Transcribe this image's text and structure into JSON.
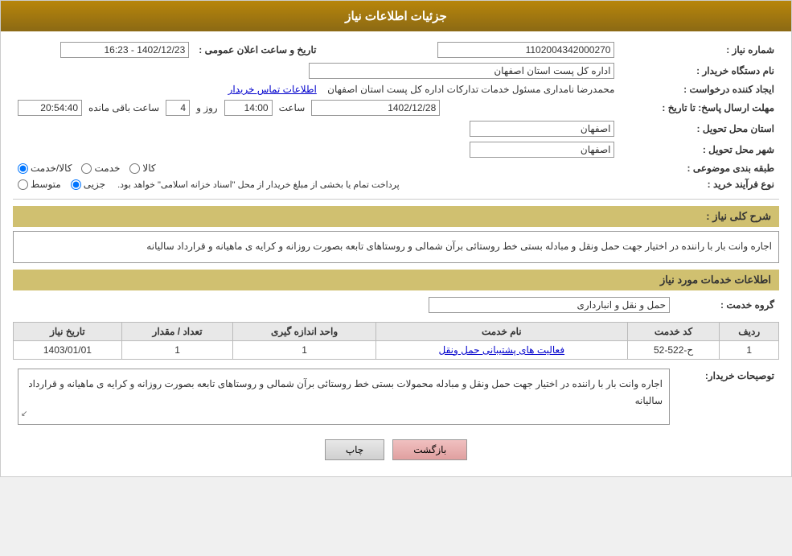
{
  "header": {
    "title": "جزئیات اطلاعات نیاز"
  },
  "labels": {
    "need_number": "شماره نیاز :",
    "buyer_org": "نام دستگاه خریدار :",
    "creator": "ایجاد کننده درخواست :",
    "deadline": "مهلت ارسال پاسخ: تا تاریخ :",
    "delivery_province": "استان محل تحویل :",
    "delivery_city": "شهر محل تحویل :",
    "subject_type": "طبقه بندی موضوعی :",
    "process_type": "نوع فرآیند خرید :",
    "need_summary": "شرح کلی نیاز:",
    "service_info_title": "اطلاعات خدمات مورد نیاز",
    "service_group": "گروه خدمت :",
    "buyer_notes": "توصیحات خریدار:",
    "announce_datetime": "تاریخ و ساعت اعلان عمومی :"
  },
  "values": {
    "need_number": "1102004342000270",
    "buyer_org": "اداره کل پست استان اصفهان",
    "creator": "محمدرضا نامداری مسئول خدمات تداركات اداره كل پست استان اصفهان",
    "creator_link": "اطلاعات تماس خریدار",
    "deadline_date": "1402/12/28",
    "deadline_time": "14:00",
    "deadline_days": "4",
    "deadline_remaining": "20:54:40",
    "delivery_province": "اصفهان",
    "delivery_city": "اصفهان",
    "announce_datetime": "1402/12/23 - 16:23",
    "subject_type_options": [
      "کالا",
      "خدمت",
      "کالا/خدمت"
    ],
    "subject_type_selected": "کالا/خدمت",
    "process_type_options": [
      "جزیی",
      "متوسط"
    ],
    "process_type_note": "پرداخت تمام یا بخشی از مبلغ خریدار از محل \"اسناد خزانه اسلامی\" خواهد بود.",
    "need_summary_text": "اجاره وانت بار با راننده در اختیار جهت حمل ونقل و مبادله بستی خط روستائی برآن شمالی و روستاهای تابعه بصورت روزانه و کرایه ی ماهیانه و قرارداد سالیانه",
    "service_group_value": "حمل و نقل و انبارداری",
    "table_headers": [
      "ردیف",
      "کد خدمت",
      "نام خدمت",
      "واحد اندازه گیری",
      "تعداد / مقدار",
      "تاریخ نیاز"
    ],
    "table_rows": [
      {
        "row": "1",
        "code": "ح-522-52",
        "name": "فعالیت های پشتیبانی حمل ونقل",
        "unit": "1",
        "qty": "1",
        "date": "1403/01/01"
      }
    ],
    "buyer_notes_text": "اجاره وانت بار با راننده در اختیار جهت حمل ونقل و مبادله محمولات  بستی خط روستائی برآن شمالی و روستاهای تابعه بصورت روزانه و کرایه ی ماهیانه و قرارداد سالیانه",
    "btn_print": "چاپ",
    "btn_back": "بازگشت",
    "remaining_label": "ساعت باقی مانده",
    "day_label": "روز و"
  }
}
